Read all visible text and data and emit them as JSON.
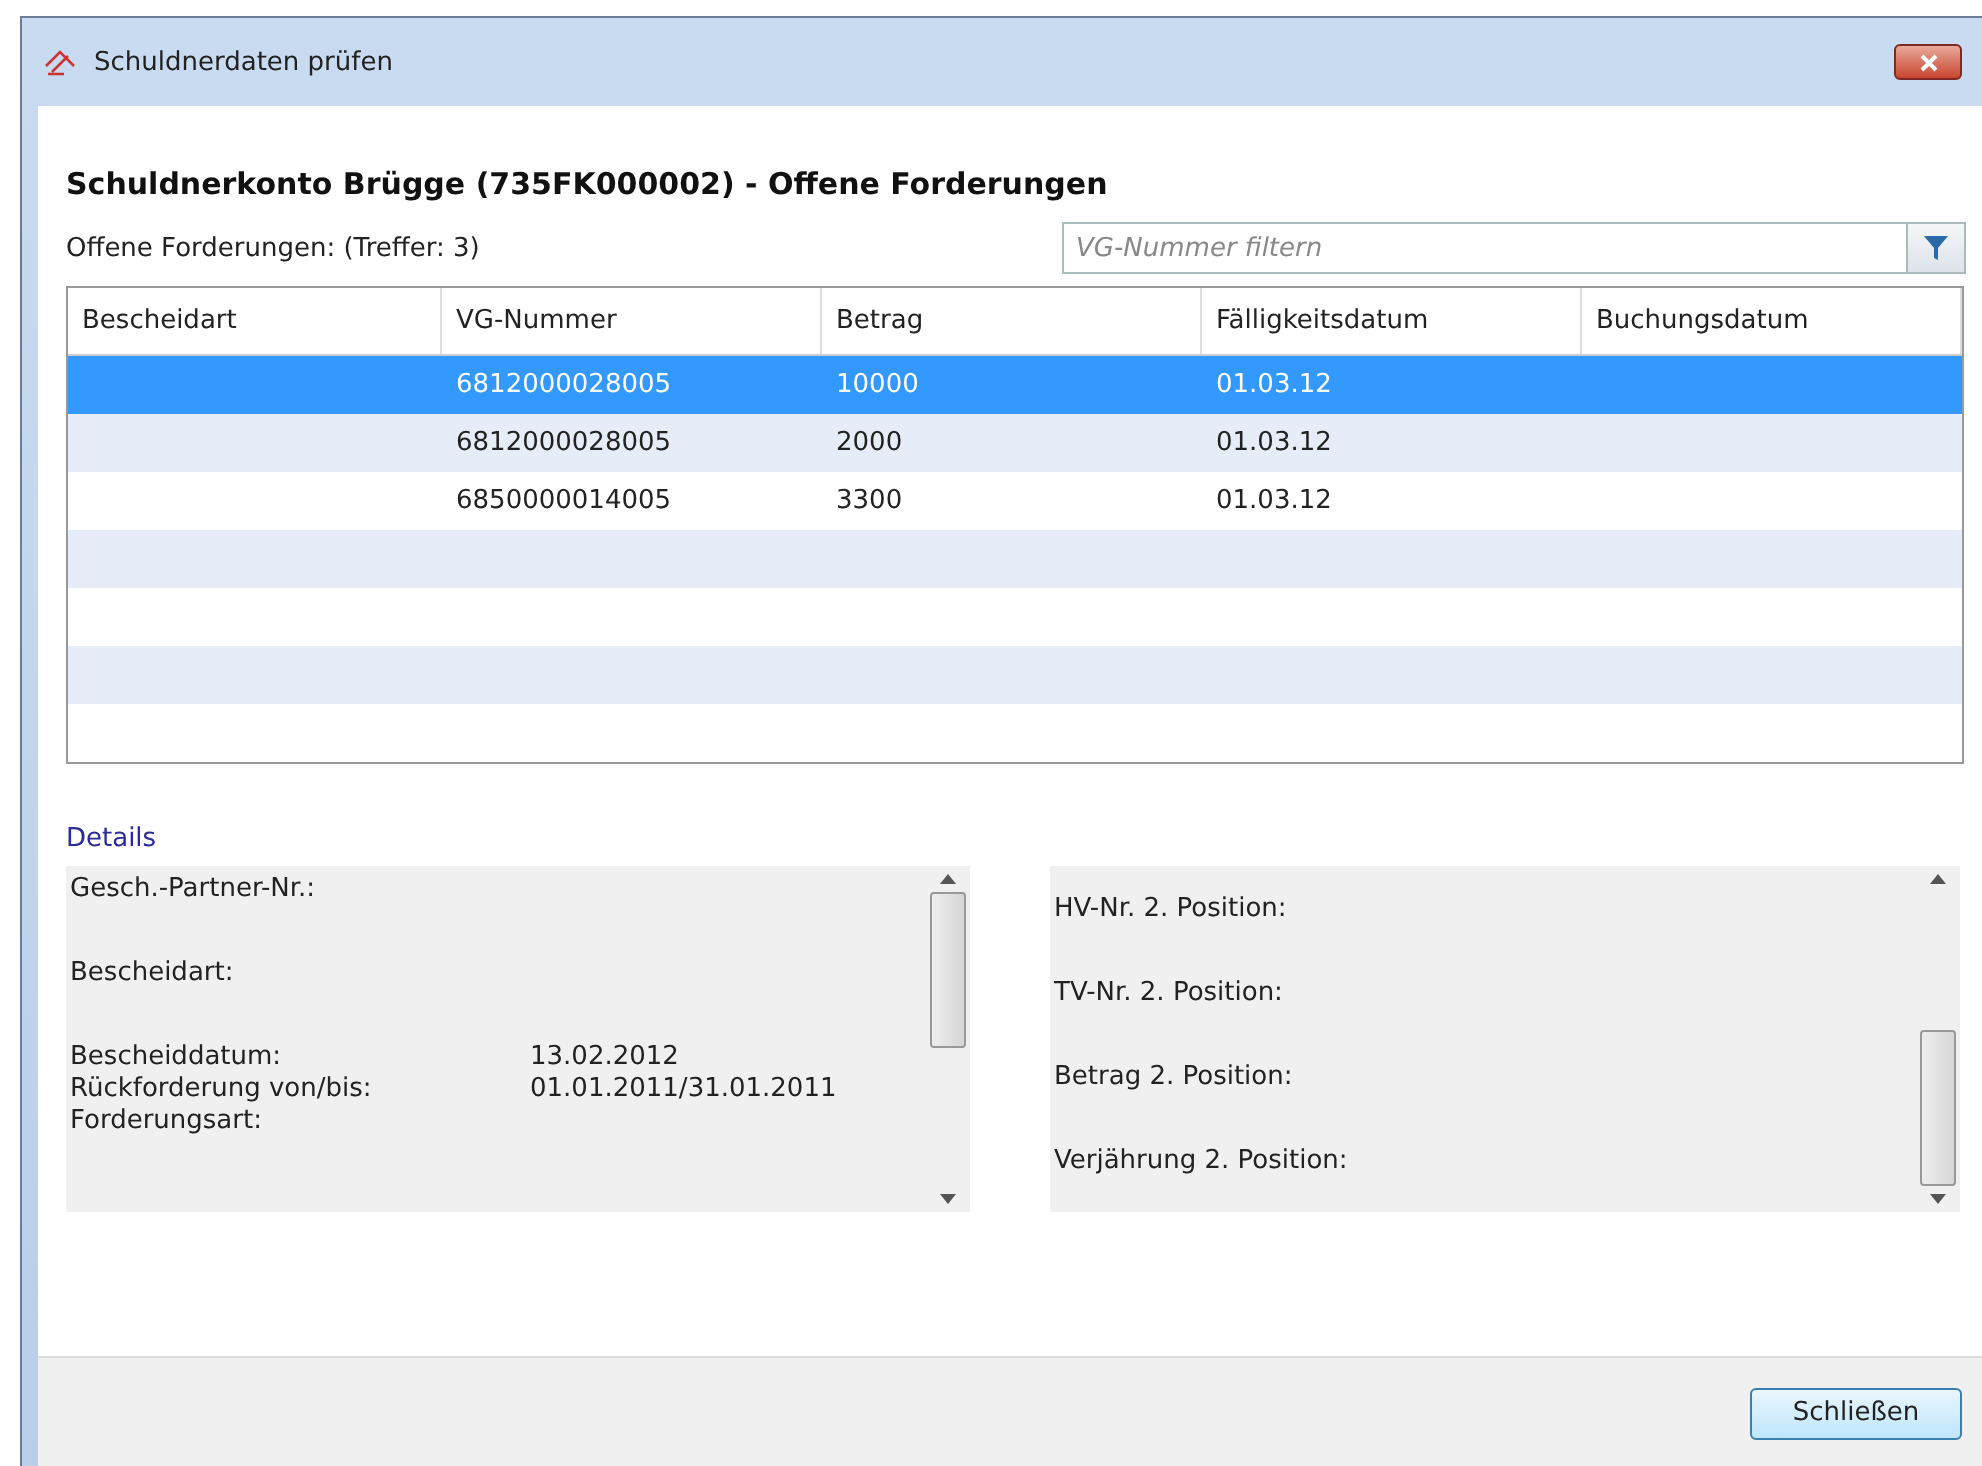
{
  "window": {
    "title": "Schuldnerdaten prüfen"
  },
  "heading": "Schuldnerkonto Brügge (735FK000002) - Offene Forderungen",
  "count_label": "Offene Forderungen: (Treffer: 3)",
  "filter": {
    "placeholder": "VG-Nummer filtern"
  },
  "table": {
    "columns": [
      "Bescheidart",
      "VG-Nummer",
      "Betrag",
      "Fälligkeitsdatum",
      "Buchungsdatum"
    ],
    "rows": [
      {
        "selected": true,
        "cells": [
          "",
          "6812000028005",
          "10000",
          "01.03.12",
          ""
        ]
      },
      {
        "selected": false,
        "cells": [
          "",
          "6812000028005",
          "2000",
          "01.03.12",
          ""
        ]
      },
      {
        "selected": false,
        "cells": [
          "",
          "6850000014005",
          "3300",
          "01.03.12",
          ""
        ]
      }
    ]
  },
  "details": {
    "title": "Details",
    "left": [
      [
        {
          "label": "Gesch.-Partner-Nr.:"
        }
      ],
      [
        {
          "label": "Bescheidart:"
        }
      ],
      [
        {
          "label": "Bescheiddatum:",
          "value": "13.02.2012"
        },
        {
          "label": "Rückforderung von/bis:",
          "value": "01.01.2011/31.01.2011"
        },
        {
          "label": "Forderungsart:"
        }
      ]
    ],
    "right": [
      [
        {
          "label": "HV-Nr. 2. Position:"
        }
      ],
      [
        {
          "label": "TV-Nr. 2. Position:"
        }
      ],
      [
        {
          "label": "Betrag 2. Position:"
        }
      ],
      [
        {
          "label": "Verjährung 2. Position:"
        }
      ]
    ]
  },
  "buttons": [
    "Schließen"
  ]
}
